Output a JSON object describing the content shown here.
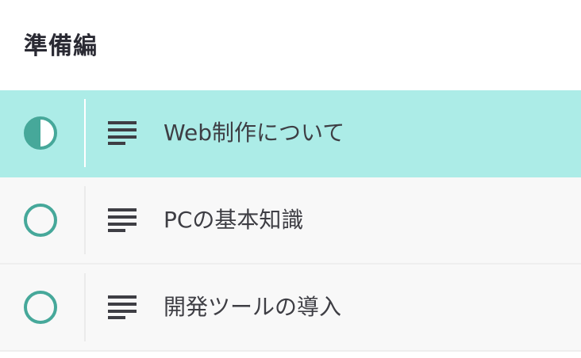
{
  "section": {
    "title": "準備編"
  },
  "lessons": [
    {
      "title": "Web制作について",
      "status": "in-progress",
      "type": "text"
    },
    {
      "title": "PCの基本知識",
      "status": "not-started",
      "type": "text"
    },
    {
      "title": "開発ツールの導入",
      "status": "not-started",
      "type": "text"
    }
  ],
  "colors": {
    "accent": "#46a89a",
    "active_row": "#acece7",
    "row_bg": "#f8f8f8",
    "text": "#3e3e44"
  }
}
